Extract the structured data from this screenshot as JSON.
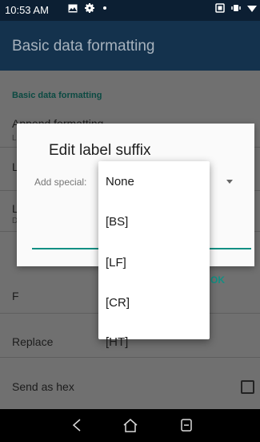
{
  "status_bar": {
    "time": "10:53 AM"
  },
  "app_bar": {
    "title": "Basic data formatting"
  },
  "settings": {
    "section_header": "Basic data formatting",
    "rows": {
      "append_formatting": "Append formatting",
      "label_l1": "L",
      "label_l2": "L",
      "label_f": "F",
      "replace": "Replace",
      "send_as_hex": "Send as hex"
    }
  },
  "dialog": {
    "title": "Edit label suffix",
    "add_special_label": "Add special:",
    "ok_label": "OK"
  },
  "dropdown": {
    "options": [
      "None",
      "[BS]",
      "[LF]",
      "[CR]",
      "[HT]"
    ]
  }
}
